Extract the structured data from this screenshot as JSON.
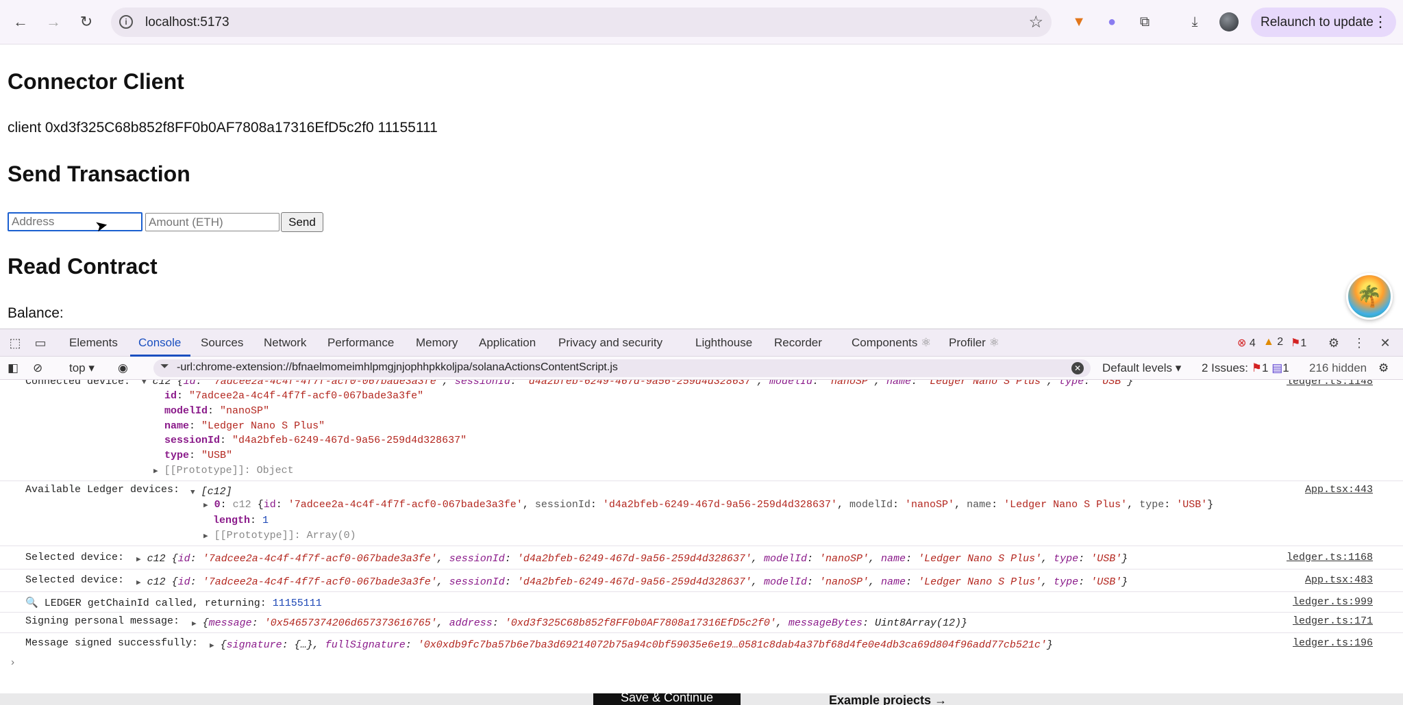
{
  "browser": {
    "url": "localhost:5173",
    "relaunch_label": "Relaunch to update"
  },
  "page": {
    "heading_connector": "Connector Client",
    "client_line": "client 0xd3f325C68b852f8FF0b0AF7808a17316EfD5c2f0 11155111",
    "heading_send": "Send Transaction",
    "address_placeholder": "Address",
    "amount_placeholder": "Amount (ETH)",
    "send_label": "Send",
    "heading_read": "Read Contract",
    "balance_label": "Balance:"
  },
  "devtools": {
    "tabs": [
      "Elements",
      "Console",
      "Sources",
      "Network",
      "Performance",
      "Memory",
      "Application",
      "Privacy and security",
      "Lighthouse",
      "Recorder",
      "Components",
      "Profiler"
    ],
    "error_count": "4",
    "warning_count": "2",
    "issue_flag_count": "1",
    "context": "top",
    "filter_text": "-url:chrome-extension://bfnaelmomeimhlpmgjnjophhpkkoljpa/solanaActionsContentScript.js",
    "levels_label": "Default levels",
    "issues_label": "2 Issues:",
    "issues_red": "1",
    "issues_blue": "1",
    "hidden_label": "216 hidden"
  },
  "console": {
    "connected_label": "Connected device:",
    "connected_src": "ledger.ts:1148",
    "device": {
      "id": "7adcee2a-4c4f-4f7f-acf0-067bade3a3fe",
      "modelId": "nanoSP",
      "name": "Ledger Nano S Plus",
      "sessionId": "d4a2bfeb-6249-467d-9a56-259d4d328637",
      "type": "USB"
    },
    "prototype_object": "[[Prototype]]: Object",
    "available_label": "Available Ledger devices:",
    "available_src": "App.tsx:443",
    "array_header": "[c12]",
    "length_value": "1",
    "prototype_array": "[[Prototype]]: Array(0)",
    "selected_label_1": "Selected device:",
    "selected_src_1": "ledger.ts:1168",
    "selected_label_2": "Selected device:",
    "selected_src_2": "App.tsx:483",
    "chainid_msg": "LEDGER getChainId called, returning:",
    "chainid_value": "11155111",
    "chainid_src": "ledger.ts:999",
    "signing_label": "Signing personal message:",
    "signing_message": "0x54657374206d657373616765",
    "signing_address": "0xd3f325C68b852f8FF0b0AF7808a17316EfD5c2f0",
    "signing_bytes": "Uint8Array(12)",
    "signing_src": "ledger.ts:171",
    "signed_label": "Message signed successfully:",
    "signed_full": "0x0xdb9fc7ba57b6e7ba3d69214072b75a94c0bf59035e6e19…0581c8dab4a37bf68d4fe0e4db3ca69d804f96add77cb521c",
    "signed_src": "ledger.ts:196"
  },
  "behind_page": {
    "save_button": "Save & Continue",
    "example_link": "Example projects →"
  }
}
